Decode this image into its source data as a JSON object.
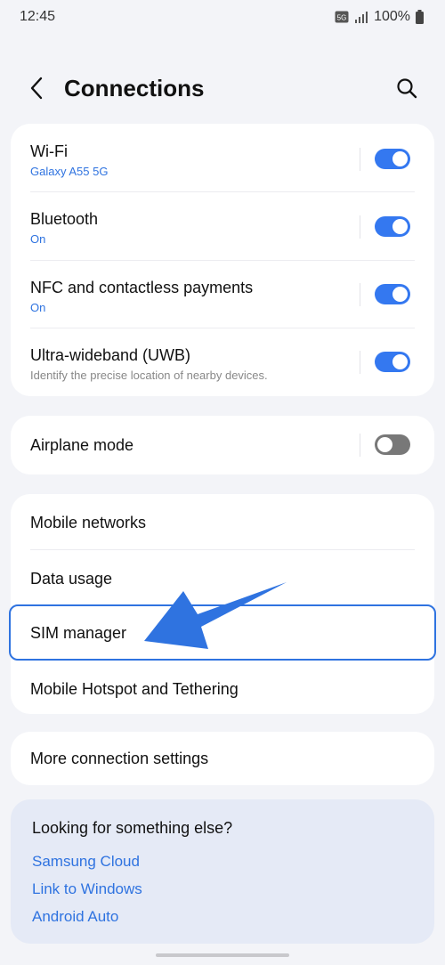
{
  "status_bar": {
    "time": "12:45",
    "battery": "100%",
    "network_badge": "5G",
    "icons": [
      "5g-icon",
      "signal-icon",
      "battery-icon"
    ]
  },
  "header": {
    "title": "Connections",
    "back_icon": "chevron-left-icon",
    "search_icon": "search-icon"
  },
  "card1": [
    {
      "title": "Wi-Fi",
      "subtitle": "Galaxy A55 5G",
      "toggle": "on"
    },
    {
      "title": "Bluetooth",
      "subtitle": "On",
      "toggle": "on"
    },
    {
      "title": "NFC and contactless payments",
      "subtitle": "On",
      "toggle": "on"
    },
    {
      "title": "Ultra-wideband (UWB)",
      "subtitle": "Identify the precise location of nearby devices.",
      "toggle": "on"
    }
  ],
  "airplane": {
    "title": "Airplane mode",
    "toggle": "off"
  },
  "card3": [
    {
      "title": "Mobile networks"
    },
    {
      "title": "Data usage"
    },
    {
      "title": "SIM manager",
      "highlighted": true
    },
    {
      "title": "Mobile Hotspot and Tethering"
    }
  ],
  "more": {
    "title": "More connection settings"
  },
  "suggestions": {
    "title": "Looking for something else?",
    "links": [
      "Samsung Cloud",
      "Link to Windows",
      "Android Auto"
    ]
  },
  "colors": {
    "accent": "#3478f0",
    "link": "#2f73e0",
    "background": "#f3f4f8",
    "toggle_off": "#787878",
    "suggest_bg": "#e5eaf6"
  }
}
